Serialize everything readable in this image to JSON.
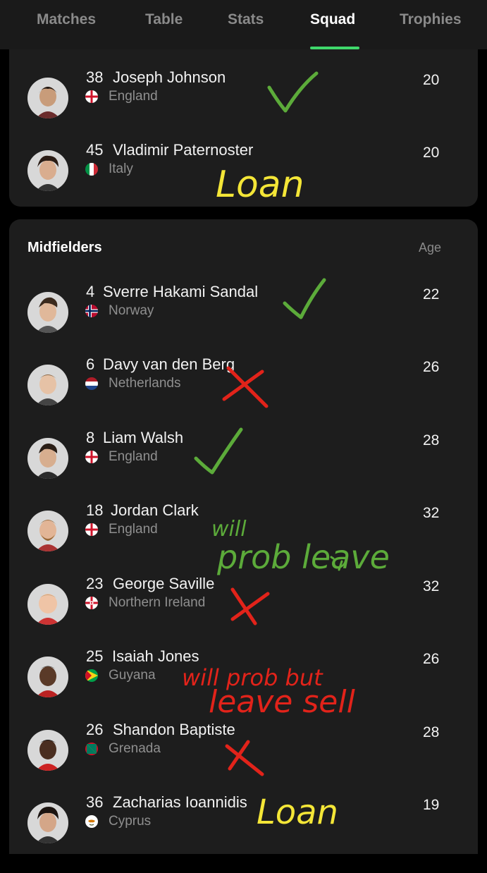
{
  "tabs": [
    {
      "label": "Matches"
    },
    {
      "label": "Table"
    },
    {
      "label": "Stats"
    },
    {
      "label": "Squad",
      "active": true
    },
    {
      "label": "Trophies"
    }
  ],
  "colors": {
    "accent": "#3fd86b",
    "background": "#000000",
    "card": "#1d1d1d",
    "secondary_text": "#8f8f8f",
    "annotation_green": "#5cab3a",
    "annotation_yellow": "#f4e637",
    "annotation_red": "#e2231a"
  },
  "top_section": {
    "players": [
      {
        "number": "38",
        "name": "Joseph Johnson",
        "country": "England",
        "flag": "england-flag",
        "age": "20"
      },
      {
        "number": "45",
        "name": "Vladimir Paternoster",
        "country": "Italy",
        "flag": "italy-flag",
        "age": "20"
      }
    ]
  },
  "midfielders": {
    "title": "Midfielders",
    "age_header": "Age",
    "players": [
      {
        "number": "4",
        "name": "Sverre Hakami Sandal",
        "country": "Norway",
        "flag": "norway-flag",
        "age": "22"
      },
      {
        "number": "6",
        "name": "Davy van den Berg",
        "country": "Netherlands",
        "flag": "netherlands-flag",
        "age": "26"
      },
      {
        "number": "8",
        "name": "Liam Walsh",
        "country": "England",
        "flag": "england-flag",
        "age": "28"
      },
      {
        "number": "18",
        "name": "Jordan Clark",
        "country": "England",
        "flag": "england-flag",
        "age": "32"
      },
      {
        "number": "23",
        "name": "George Saville",
        "country": "Northern Ireland",
        "flag": "northern-ireland-flag",
        "age": "32"
      },
      {
        "number": "25",
        "name": "Isaiah Jones",
        "country": "Guyana",
        "flag": "guyana-flag",
        "age": "26"
      },
      {
        "number": "26",
        "name": "Shandon Baptiste",
        "country": "Grenada",
        "flag": "grenada-flag",
        "age": "28"
      },
      {
        "number": "36",
        "name": "Zacharias Ioannidis",
        "country": "Cyprus",
        "flag": "cyprus-flag",
        "age": "19"
      }
    ]
  },
  "annotations": {
    "loan_1": "Loan",
    "will_prob_leave_line1": "will",
    "will_prob_leave_line2": "prob leave",
    "will_prob_but_line1": "will prob but",
    "will_prob_but_line2": "leave sell",
    "loan_2": "Loan"
  }
}
